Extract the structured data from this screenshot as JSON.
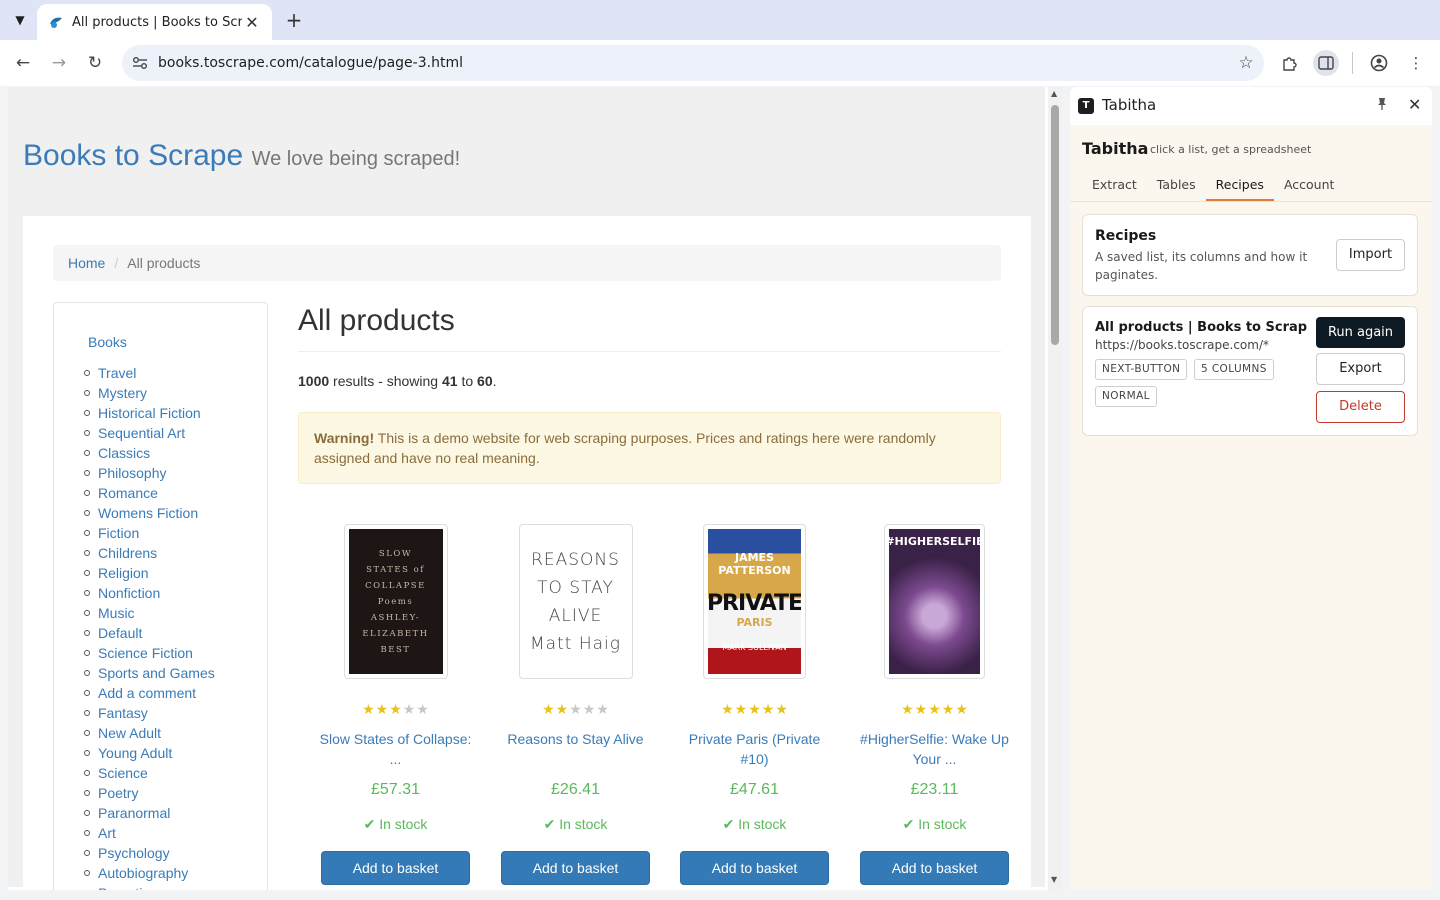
{
  "browser": {
    "tab_title": "All products | Books to Scrape - Sandbox",
    "url": "books.toscrape.com/catalogue/page-3.html"
  },
  "site": {
    "brand": "Books to Scrape",
    "tagline": "We love being scraped!",
    "breadcrumb": {
      "home": "Home",
      "current": "All products"
    },
    "sidebar": {
      "root": "Books",
      "categories": [
        "Travel",
        "Mystery",
        "Historical Fiction",
        "Sequential Art",
        "Classics",
        "Philosophy",
        "Romance",
        "Womens Fiction",
        "Fiction",
        "Childrens",
        "Religion",
        "Nonfiction",
        "Music",
        "Default",
        "Science Fiction",
        "Sports and Games",
        "Add a comment",
        "Fantasy",
        "New Adult",
        "Young Adult",
        "Science",
        "Poetry",
        "Paranormal",
        "Art",
        "Psychology",
        "Autobiography",
        "Parenting"
      ]
    },
    "main": {
      "title": "All products",
      "results": {
        "count": "1000",
        "text_a": " results - showing ",
        "from": "41",
        "text_b": " to ",
        "to": "60",
        "text_c": "."
      },
      "warning": {
        "strong": "Warning!",
        "text": " This is a demo website for web scraping purposes. Prices and ratings here were randomly assigned and have no real meaning."
      }
    },
    "products": [
      {
        "title": "Slow States of Collapse: ...",
        "price": "£57.31",
        "rating": 3,
        "stock": "In stock",
        "button": "Add to basket",
        "cover": {
          "bg": "#1e1515",
          "text": "SLOW\nSTATES of\nCOLLAPSE\nPoems\nASHLEY-\nELIZABETH\nBEST",
          "color": "#c9b8a8"
        }
      },
      {
        "title": "Reasons to Stay Alive",
        "price": "£26.41",
        "rating": 2,
        "stock": "In stock",
        "button": "Add to basket",
        "cover": {
          "bg": "#ffffff",
          "text": "REASONS\nTO STAY\nALIVE\nMatt Haig",
          "color": "#444444"
        }
      },
      {
        "title": "Private Paris (Private #10)",
        "price": "£47.61",
        "rating": 5,
        "stock": "In stock",
        "button": "Add to basket",
        "cover": {
          "bg": "#f2f2f2",
          "text": "JAMES PATTERSON\nPRIVATE\nPARIS\nMARK SULLIVAN",
          "color": "#111111"
        }
      },
      {
        "title": "#HigherSelfie: Wake Up Your ...",
        "price": "£23.11",
        "rating": 5,
        "stock": "In stock",
        "button": "Add to basket",
        "cover": {
          "bg": "#3a2147",
          "text": "#HIGHERSELFIE",
          "color": "#ffffff"
        }
      }
    ]
  },
  "panel": {
    "name": "Tabitha",
    "brand": "Tabitha",
    "tagline": "click a list, get a spreadsheet",
    "tabs": [
      "Extract",
      "Tables",
      "Recipes",
      "Account"
    ],
    "active_tab": "Recipes",
    "recipes_card": {
      "title": "Recipes",
      "description": "A saved list, its columns and how it paginates.",
      "import_label": "Import"
    },
    "recipe": {
      "title": "All products | Books to Scrape - Sandbox",
      "url": "https://books.toscrape.com/*",
      "chips": [
        "NEXT-BUTTON",
        "5 COLUMNS",
        "NORMAL"
      ],
      "run_label": "Run again",
      "export_label": "Export",
      "delete_label": "Delete"
    }
  },
  "colors": {
    "link": "#3a7bb8",
    "price_green": "#5cb85c",
    "button_blue": "#337ab7",
    "accent_orange": "#e07b39",
    "delete_red": "#c0392b"
  }
}
